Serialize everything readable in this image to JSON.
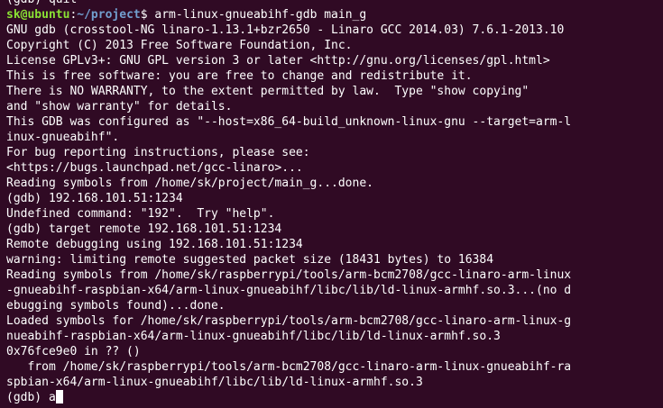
{
  "terminal": {
    "top_partial": "(gdb) quit",
    "prompt": {
      "user_host": "sk@ubuntu",
      "colon": ":",
      "path": "~/project",
      "dollar": "$ ",
      "command": "arm-linux-gnueabihf-gdb main_g"
    },
    "lines": [
      "GNU gdb (crosstool-NG linaro-1.13.1+bzr2650 - Linaro GCC 2014.03) 7.6.1-2013.10",
      "Copyright (C) 2013 Free Software Foundation, Inc.",
      "License GPLv3+: GNU GPL version 3 or later <http://gnu.org/licenses/gpl.html>",
      "This is free software: you are free to change and redistribute it.",
      "There is NO WARRANTY, to the extent permitted by law.  Type \"show copying\"",
      "and \"show warranty\" for details.",
      "This GDB was configured as \"--host=x86_64-build_unknown-linux-gnu --target=arm-l",
      "inux-gnueabihf\".",
      "For bug reporting instructions, please see:",
      "<https://bugs.launchpad.net/gcc-linaro>...",
      "Reading symbols from /home/sk/project/main_g...done.",
      "(gdb) 192.168.101.51:1234",
      "Undefined command: \"192\".  Try \"help\".",
      "(gdb) target remote 192.168.101.51:1234",
      "Remote debugging using 192.168.101.51:1234",
      "warning: limiting remote suggested packet size (18431 bytes) to 16384",
      "Reading symbols from /home/sk/raspberrypi/tools/arm-bcm2708/gcc-linaro-arm-linux",
      "-gnueabihf-raspbian-x64/arm-linux-gnueabihf/libc/lib/ld-linux-armhf.so.3...(no d",
      "ebugging symbols found)...done.",
      "Loaded symbols for /home/sk/raspberrypi/tools/arm-bcm2708/gcc-linaro-arm-linux-g",
      "nueabihf-raspbian-x64/arm-linux-gnueabihf/libc/lib/ld-linux-armhf.so.3",
      "0x76fce9e0 in ?? ()",
      "   from /home/sk/raspberrypi/tools/arm-bcm2708/gcc-linaro-arm-linux-gnueabihf-ra",
      "spbian-x64/arm-linux-gnueabihf/libc/lib/ld-linux-armhf.so.3"
    ],
    "last_prompt": "(gdb) ",
    "current_input": "a"
  },
  "colors": {
    "background": "#300a24",
    "text": "#ffffff",
    "user_host": "#8ae234",
    "path": "#729fcf"
  }
}
